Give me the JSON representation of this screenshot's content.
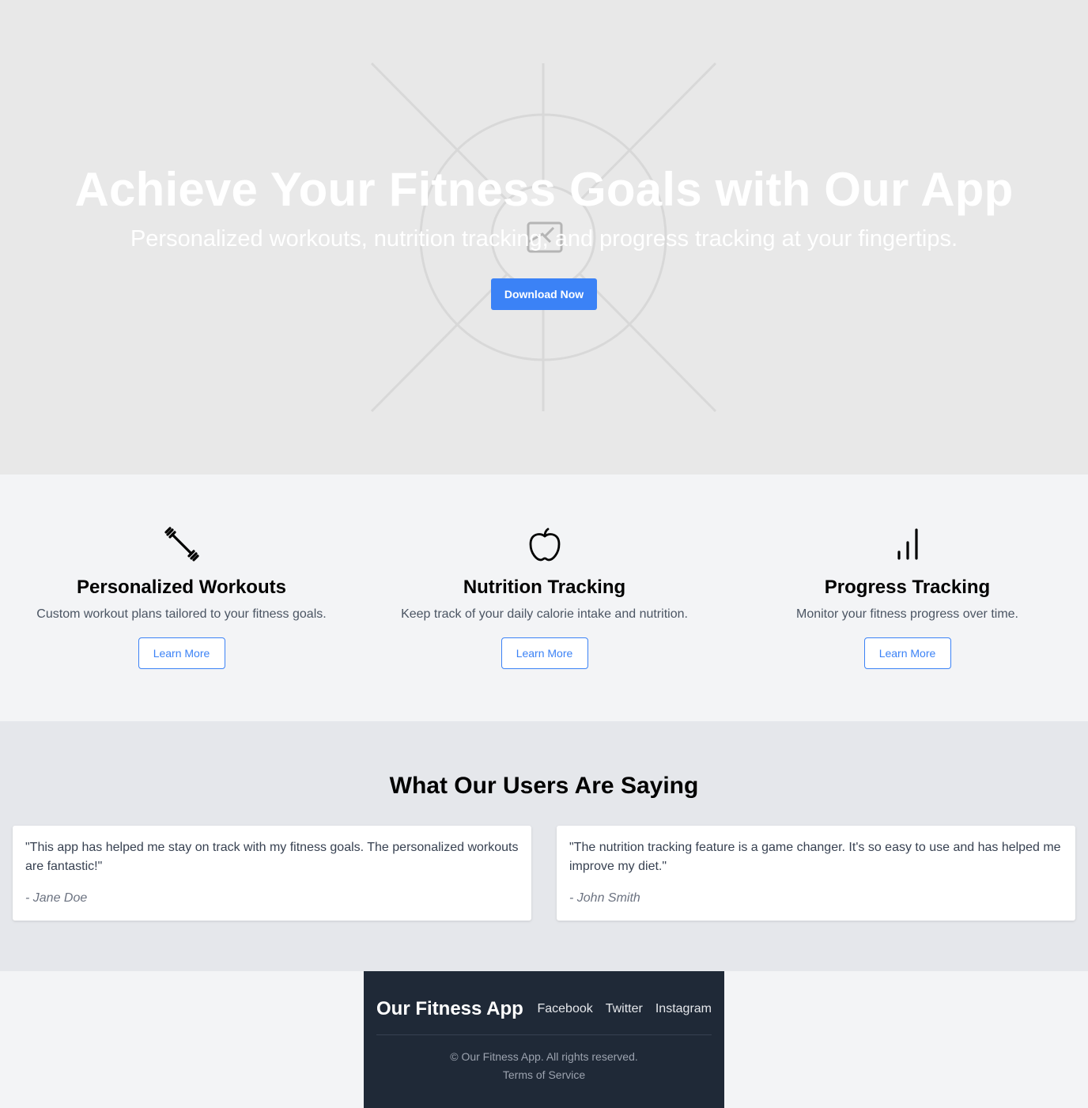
{
  "hero": {
    "title": "Achieve Your Fitness Goals with Our App",
    "subtitle": "Personalized workouts, nutrition tracking, and progress tracking at your fingertips.",
    "cta_label": "Download Now",
    "background_icon": "image-placeholder-icon"
  },
  "features": [
    {
      "icon": "dumbbell-icon",
      "title": "Personalized Workouts",
      "description": "Custom workout plans tailored to your fitness goals.",
      "button_label": "Learn More"
    },
    {
      "icon": "apple-icon",
      "title": "Nutrition Tracking",
      "description": "Keep track of your daily calorie intake and nutrition.",
      "button_label": "Learn More"
    },
    {
      "icon": "bar-chart-icon",
      "title": "Progress Tracking",
      "description": "Monitor your fitness progress over time.",
      "button_label": "Learn More"
    }
  ],
  "testimonials": {
    "heading": "What Our Users Are Saying",
    "items": [
      {
        "quote": "\"This app has helped me stay on track with my fitness goals. The personalized workouts are fantastic!\"",
        "author": "- Jane Doe"
      },
      {
        "quote": "\"The nutrition tracking feature is a game changer. It's so easy to use and has helped me improve my diet.\"",
        "author": "- John Smith"
      }
    ]
  },
  "footer": {
    "brand": "Our Fitness App",
    "links": [
      "Facebook",
      "Twitter",
      "Instagram"
    ],
    "copyright": "© Our Fitness App. All rights reserved.",
    "terms": "Terms of Service"
  },
  "colors": {
    "accent": "#3b82f6",
    "hero_bg": "#e8e8e8",
    "footer_bg": "#1f2937",
    "section_bg": "#f3f4f6",
    "testimonial_bg": "#e5e7eb"
  }
}
